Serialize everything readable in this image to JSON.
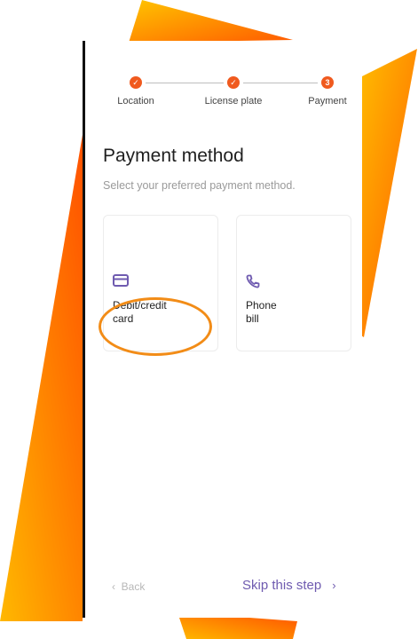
{
  "stepper": {
    "steps": [
      {
        "label": "Location",
        "state": "done"
      },
      {
        "label": "License plate",
        "state": "done"
      },
      {
        "label": "Payment",
        "state": "current",
        "number": "3"
      }
    ],
    "accent": "#f05a1e"
  },
  "page": {
    "title": "Payment method",
    "subtitle": "Select your preferred payment method."
  },
  "options": [
    {
      "label_line1": "Debit/credit",
      "label_line2": "card",
      "icon": "credit-card-icon"
    },
    {
      "label_line1": "Phone",
      "label_line2": "bill",
      "icon": "phone-icon"
    }
  ],
  "footer": {
    "back_label": "Back",
    "skip_label": "Skip this step"
  },
  "colors": {
    "icon_purple": "#6f5bb0",
    "highlight_orange": "#f28c17"
  }
}
